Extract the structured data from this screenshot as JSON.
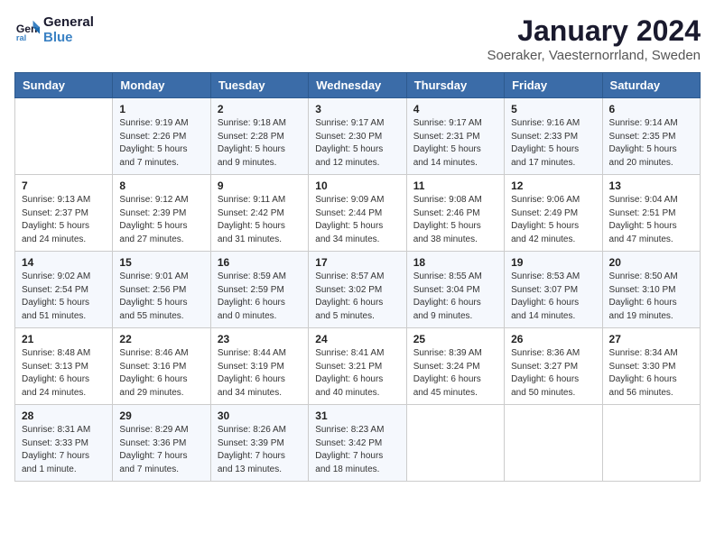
{
  "logo": {
    "line1": "General",
    "line2": "Blue"
  },
  "title": "January 2024",
  "subtitle": "Soeraker, Vaesternorrland, Sweden",
  "headers": [
    "Sunday",
    "Monday",
    "Tuesday",
    "Wednesday",
    "Thursday",
    "Friday",
    "Saturday"
  ],
  "weeks": [
    [
      {
        "day": "",
        "info": ""
      },
      {
        "day": "1",
        "info": "Sunrise: 9:19 AM\nSunset: 2:26 PM\nDaylight: 5 hours\nand 7 minutes."
      },
      {
        "day": "2",
        "info": "Sunrise: 9:18 AM\nSunset: 2:28 PM\nDaylight: 5 hours\nand 9 minutes."
      },
      {
        "day": "3",
        "info": "Sunrise: 9:17 AM\nSunset: 2:30 PM\nDaylight: 5 hours\nand 12 minutes."
      },
      {
        "day": "4",
        "info": "Sunrise: 9:17 AM\nSunset: 2:31 PM\nDaylight: 5 hours\nand 14 minutes."
      },
      {
        "day": "5",
        "info": "Sunrise: 9:16 AM\nSunset: 2:33 PM\nDaylight: 5 hours\nand 17 minutes."
      },
      {
        "day": "6",
        "info": "Sunrise: 9:14 AM\nSunset: 2:35 PM\nDaylight: 5 hours\nand 20 minutes."
      }
    ],
    [
      {
        "day": "7",
        "info": "Sunrise: 9:13 AM\nSunset: 2:37 PM\nDaylight: 5 hours\nand 24 minutes."
      },
      {
        "day": "8",
        "info": "Sunrise: 9:12 AM\nSunset: 2:39 PM\nDaylight: 5 hours\nand 27 minutes."
      },
      {
        "day": "9",
        "info": "Sunrise: 9:11 AM\nSunset: 2:42 PM\nDaylight: 5 hours\nand 31 minutes."
      },
      {
        "day": "10",
        "info": "Sunrise: 9:09 AM\nSunset: 2:44 PM\nDaylight: 5 hours\nand 34 minutes."
      },
      {
        "day": "11",
        "info": "Sunrise: 9:08 AM\nSunset: 2:46 PM\nDaylight: 5 hours\nand 38 minutes."
      },
      {
        "day": "12",
        "info": "Sunrise: 9:06 AM\nSunset: 2:49 PM\nDaylight: 5 hours\nand 42 minutes."
      },
      {
        "day": "13",
        "info": "Sunrise: 9:04 AM\nSunset: 2:51 PM\nDaylight: 5 hours\nand 47 minutes."
      }
    ],
    [
      {
        "day": "14",
        "info": "Sunrise: 9:02 AM\nSunset: 2:54 PM\nDaylight: 5 hours\nand 51 minutes."
      },
      {
        "day": "15",
        "info": "Sunrise: 9:01 AM\nSunset: 2:56 PM\nDaylight: 5 hours\nand 55 minutes."
      },
      {
        "day": "16",
        "info": "Sunrise: 8:59 AM\nSunset: 2:59 PM\nDaylight: 6 hours\nand 0 minutes."
      },
      {
        "day": "17",
        "info": "Sunrise: 8:57 AM\nSunset: 3:02 PM\nDaylight: 6 hours\nand 5 minutes."
      },
      {
        "day": "18",
        "info": "Sunrise: 8:55 AM\nSunset: 3:04 PM\nDaylight: 6 hours\nand 9 minutes."
      },
      {
        "day": "19",
        "info": "Sunrise: 8:53 AM\nSunset: 3:07 PM\nDaylight: 6 hours\nand 14 minutes."
      },
      {
        "day": "20",
        "info": "Sunrise: 8:50 AM\nSunset: 3:10 PM\nDaylight: 6 hours\nand 19 minutes."
      }
    ],
    [
      {
        "day": "21",
        "info": "Sunrise: 8:48 AM\nSunset: 3:13 PM\nDaylight: 6 hours\nand 24 minutes."
      },
      {
        "day": "22",
        "info": "Sunrise: 8:46 AM\nSunset: 3:16 PM\nDaylight: 6 hours\nand 29 minutes."
      },
      {
        "day": "23",
        "info": "Sunrise: 8:44 AM\nSunset: 3:19 PM\nDaylight: 6 hours\nand 34 minutes."
      },
      {
        "day": "24",
        "info": "Sunrise: 8:41 AM\nSunset: 3:21 PM\nDaylight: 6 hours\nand 40 minutes."
      },
      {
        "day": "25",
        "info": "Sunrise: 8:39 AM\nSunset: 3:24 PM\nDaylight: 6 hours\nand 45 minutes."
      },
      {
        "day": "26",
        "info": "Sunrise: 8:36 AM\nSunset: 3:27 PM\nDaylight: 6 hours\nand 50 minutes."
      },
      {
        "day": "27",
        "info": "Sunrise: 8:34 AM\nSunset: 3:30 PM\nDaylight: 6 hours\nand 56 minutes."
      }
    ],
    [
      {
        "day": "28",
        "info": "Sunrise: 8:31 AM\nSunset: 3:33 PM\nDaylight: 7 hours\nand 1 minute."
      },
      {
        "day": "29",
        "info": "Sunrise: 8:29 AM\nSunset: 3:36 PM\nDaylight: 7 hours\nand 7 minutes."
      },
      {
        "day": "30",
        "info": "Sunrise: 8:26 AM\nSunset: 3:39 PM\nDaylight: 7 hours\nand 13 minutes."
      },
      {
        "day": "31",
        "info": "Sunrise: 8:23 AM\nSunset: 3:42 PM\nDaylight: 7 hours\nand 18 minutes."
      },
      {
        "day": "",
        "info": ""
      },
      {
        "day": "",
        "info": ""
      },
      {
        "day": "",
        "info": ""
      }
    ]
  ]
}
